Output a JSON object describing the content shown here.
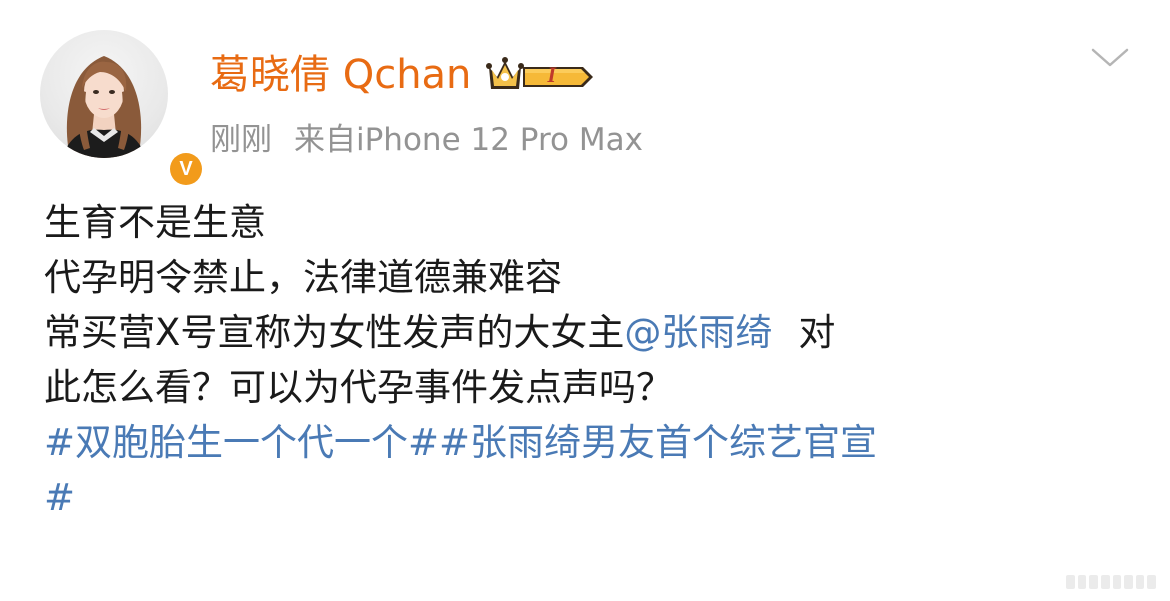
{
  "post": {
    "author": {
      "name": "葛晓倩 Qchan",
      "verified_badge_letter": "V",
      "member_level": "I",
      "verified_color": "#f29b1b",
      "name_color": "#e86b13"
    },
    "meta": {
      "time": "刚刚",
      "source": "来自iPhone 12 Pro Max"
    },
    "content": {
      "line1": "生育不是生意",
      "line2": "代孕明令禁止，法律道德兼难容",
      "line3_prefix": "常买营X号宣称为女性发声的大女主",
      "mention": "@张雨绮",
      "line3_suffix": "对",
      "line4": "此怎么看？可以为代孕事件发点声吗？",
      "hashtag1": "#双胞胎生一个代一个#",
      "hashtag2_part1": "#张雨绮男友首个综艺官宣",
      "hashtag2_part2": "#"
    },
    "colors": {
      "link": "#4a7ab5",
      "meta": "#939393",
      "text": "#1a1a1a"
    },
    "icons": {
      "menu": "chevron-down-icon",
      "member": "crown-member-icon",
      "verified": "verified-v-icon"
    }
  }
}
